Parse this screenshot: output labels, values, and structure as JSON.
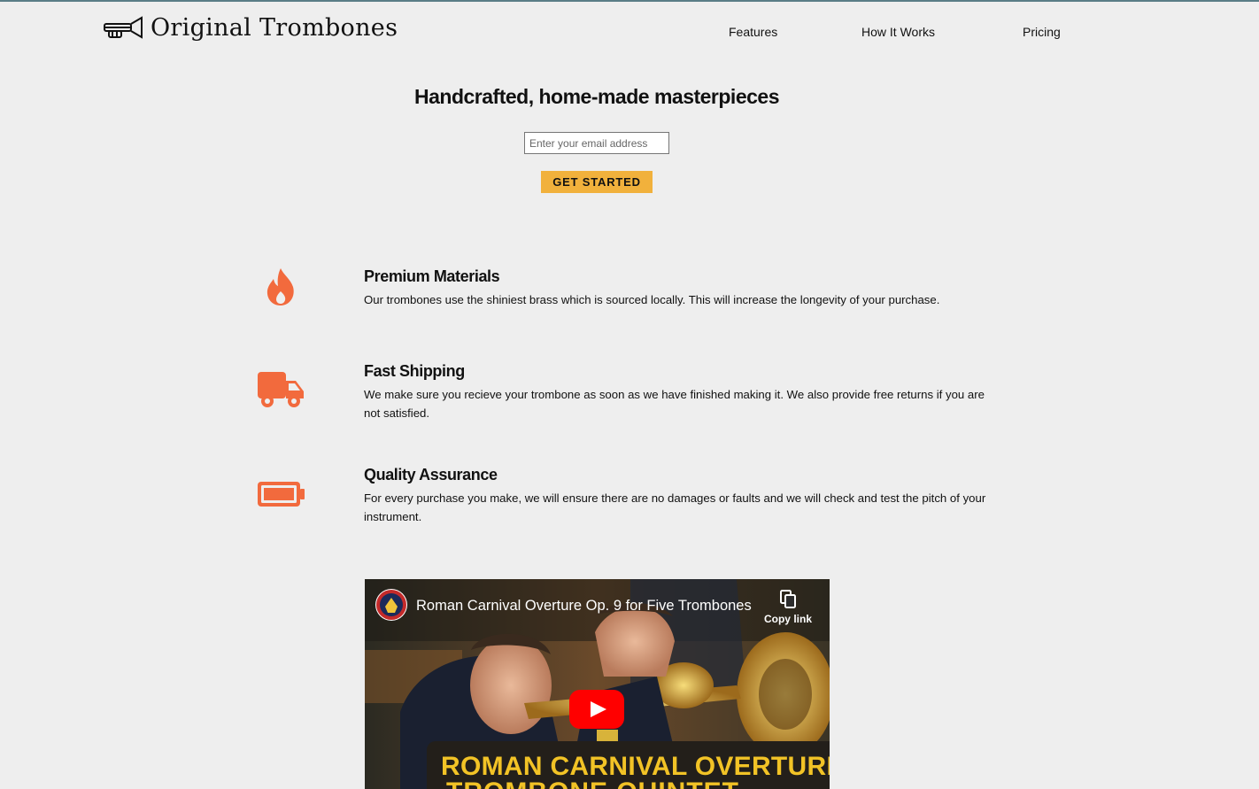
{
  "brand": {
    "name": "Original Trombones",
    "logo_icon": "trombone-icon"
  },
  "nav": {
    "items": [
      "Features",
      "How It Works",
      "Pricing"
    ]
  },
  "hero": {
    "title": "Handcrafted, home-made masterpieces",
    "email_placeholder": "Enter your email address",
    "cta_label": "GET STARTED"
  },
  "features": [
    {
      "icon": "fire-icon",
      "title": "Premium Materials",
      "text": "Our trombones use the shiniest brass which is sourced locally. This will increase the longevity of your purchase."
    },
    {
      "icon": "truck-icon",
      "title": "Fast Shipping",
      "text": "We make sure you recieve your trombone as soon as we have finished making it. We also provide free returns if you are not satisfied."
    },
    {
      "icon": "battery-icon",
      "title": "Quality Assurance",
      "text": "For every purchase you make, we will ensure there are no damages or faults and we will check and test the pitch of your instrument."
    }
  ],
  "video": {
    "title": "Roman Carnival Overture Op. 9 for Five Trombones",
    "copy_link_label": "Copy link",
    "banner_line1": "ROMAN CARNIVAL OVERTURE",
    "banner_line2": "TROMBONE QUINTET"
  },
  "colors": {
    "accent": "#f1b13c",
    "icon": "#f26a3d",
    "background": "#eeeeee"
  }
}
